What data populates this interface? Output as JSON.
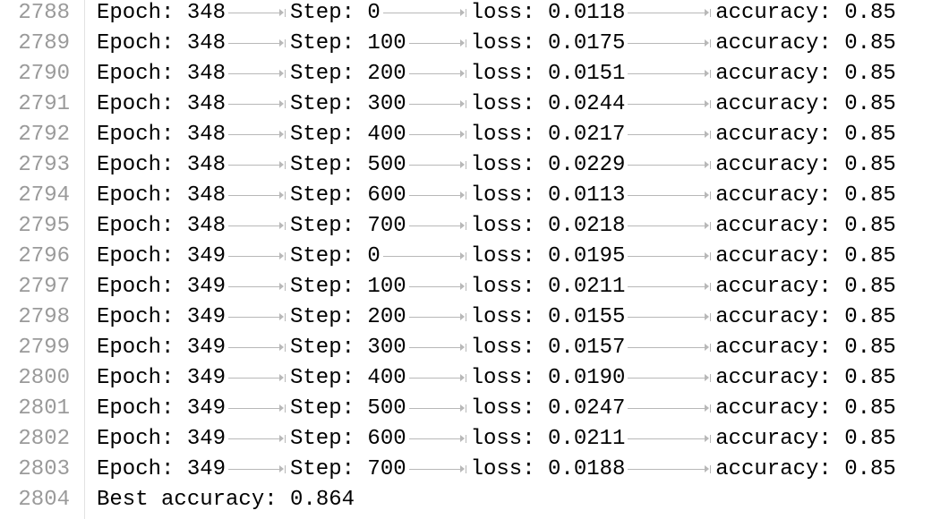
{
  "log": {
    "lines": [
      {
        "num": "2788",
        "epoch": "Epoch: 348",
        "step": "Step: 0",
        "loss": "loss: 0.0118",
        "acc": "accuracy: 0.85"
      },
      {
        "num": "2789",
        "epoch": "Epoch: 348",
        "step": "Step: 100",
        "loss": "loss: 0.0175",
        "acc": "accuracy: 0.85"
      },
      {
        "num": "2790",
        "epoch": "Epoch: 348",
        "step": "Step: 200",
        "loss": "loss: 0.0151",
        "acc": "accuracy: 0.85"
      },
      {
        "num": "2791",
        "epoch": "Epoch: 348",
        "step": "Step: 300",
        "loss": "loss: 0.0244",
        "acc": "accuracy: 0.85"
      },
      {
        "num": "2792",
        "epoch": "Epoch: 348",
        "step": "Step: 400",
        "loss": "loss: 0.0217",
        "acc": "accuracy: 0.85"
      },
      {
        "num": "2793",
        "epoch": "Epoch: 348",
        "step": "Step: 500",
        "loss": "loss: 0.0229",
        "acc": "accuracy: 0.85"
      },
      {
        "num": "2794",
        "epoch": "Epoch: 348",
        "step": "Step: 600",
        "loss": "loss: 0.0113",
        "acc": "accuracy: 0.85"
      },
      {
        "num": "2795",
        "epoch": "Epoch: 348",
        "step": "Step: 700",
        "loss": "loss: 0.0218",
        "acc": "accuracy: 0.85"
      },
      {
        "num": "2796",
        "epoch": "Epoch: 349",
        "step": "Step: 0",
        "loss": "loss: 0.0195",
        "acc": "accuracy: 0.85"
      },
      {
        "num": "2797",
        "epoch": "Epoch: 349",
        "step": "Step: 100",
        "loss": "loss: 0.0211",
        "acc": "accuracy: 0.85"
      },
      {
        "num": "2798",
        "epoch": "Epoch: 349",
        "step": "Step: 200",
        "loss": "loss: 0.0155",
        "acc": "accuracy: 0.85"
      },
      {
        "num": "2799",
        "epoch": "Epoch: 349",
        "step": "Step: 300",
        "loss": "loss: 0.0157",
        "acc": "accuracy: 0.85"
      },
      {
        "num": "2800",
        "epoch": "Epoch: 349",
        "step": "Step: 400",
        "loss": "loss: 0.0190",
        "acc": "accuracy: 0.85"
      },
      {
        "num": "2801",
        "epoch": "Epoch: 349",
        "step": "Step: 500",
        "loss": "loss: 0.0247",
        "acc": "accuracy: 0.85"
      },
      {
        "num": "2802",
        "epoch": "Epoch: 349",
        "step": "Step: 600",
        "loss": "loss: 0.0211",
        "acc": "accuracy: 0.85"
      },
      {
        "num": "2803",
        "epoch": "Epoch: 349",
        "step": "Step: 700",
        "loss": "loss: 0.0188",
        "acc": "accuracy: 0.85"
      }
    ],
    "final": {
      "num": "2804",
      "text": "Best accuracy: 0.864"
    }
  },
  "colors": {
    "text": "#000000",
    "line_number": "#9a9a9a",
    "whitespace_marker": "#b8b8b8",
    "gutter_border": "#e2e2e2",
    "background": "#ffffff"
  },
  "icons": {
    "tab_marker": "tab-arrow-icon"
  }
}
